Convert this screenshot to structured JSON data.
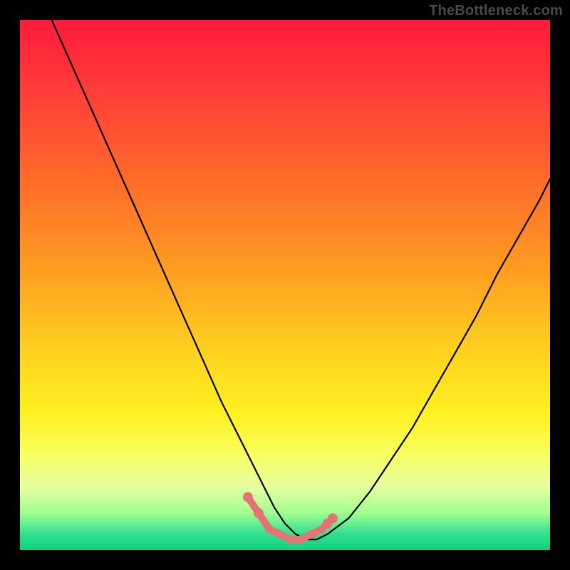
{
  "watermark": "TheBottleneck.com",
  "chart_data": {
    "type": "line",
    "title": "",
    "xlabel": "",
    "ylabel": "",
    "xlim": [
      0,
      100
    ],
    "ylim": [
      0,
      100
    ],
    "grid": false,
    "background_gradient": [
      "#ff1a3a",
      "#ff6a2a",
      "#ffd020",
      "#f8ff60",
      "#30e090"
    ],
    "series": [
      {
        "name": "bottleneck-curve",
        "color": "#000000",
        "x": [
          6,
          10,
          14,
          18,
          22,
          26,
          30,
          34,
          38,
          42,
          46,
          48,
          50,
          52,
          54,
          56,
          58,
          62,
          66,
          70,
          74,
          78,
          82,
          86,
          90,
          94,
          98,
          100
        ],
        "values": [
          100,
          91,
          82,
          73,
          64,
          55,
          46,
          37,
          28,
          20,
          12,
          8,
          5,
          3,
          2,
          2,
          3,
          6,
          11,
          17,
          23,
          30,
          37,
          44,
          52,
          59,
          66,
          70
        ]
      },
      {
        "name": "optimal-markers",
        "color": "#e57373",
        "type": "scatter",
        "x": [
          43,
          45,
          47,
          49,
          51,
          53,
          55,
          57,
          58,
          59
        ],
        "values": [
          10,
          7,
          4,
          3,
          2,
          2,
          3,
          4,
          5,
          6
        ]
      }
    ],
    "annotations": []
  }
}
